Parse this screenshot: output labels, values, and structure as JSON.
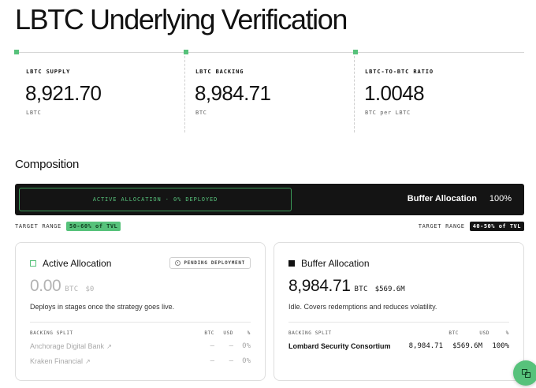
{
  "page": {
    "title": "LBTC Underlying Verification"
  },
  "stats": [
    {
      "label": "LBTC SUPPLY",
      "value": "8,921.70",
      "unit": "LBTC"
    },
    {
      "label": "LBTC BACKING",
      "value": "8,984.71",
      "unit": "BTC"
    },
    {
      "label": "LBTC-TO-BTC RATIO",
      "value": "1.0048",
      "unit": "BTC per LBTC"
    }
  ],
  "composition": {
    "title": "Composition",
    "bar": {
      "active_label": "ACTIVE ALLOCATION · 0% DEPLOYED",
      "buffer_label": "Buffer Allocation",
      "buffer_pct": "100%",
      "active_fraction": 0
    },
    "ranges": {
      "left_label": "TARGET RANGE",
      "left_badge": "50-60% of TVL",
      "right_label": "TARGET RANGE",
      "right_badge": "40-50% of TVL"
    }
  },
  "active_card": {
    "title": "Active Allocation",
    "badge": "PENDING DEPLOYMENT",
    "amount": "0.00",
    "unit": "BTC",
    "usd": "$0",
    "description": "Deploys in stages once the strategy goes live.",
    "split_header": {
      "name": "BACKING SPLIT",
      "btc": "BTC",
      "usd": "USD",
      "pct": "%"
    },
    "rows": [
      {
        "name": "Anchorage Digital Bank",
        "ext": "↗",
        "btc": "–",
        "usd": "–",
        "pct": "0%"
      },
      {
        "name": "Kraken Financial",
        "ext": "↗",
        "btc": "–",
        "usd": "–",
        "pct": "0%"
      }
    ]
  },
  "buffer_card": {
    "title": "Buffer Allocation",
    "amount": "8,984.71",
    "unit": "BTC",
    "usd": "$569.6M",
    "description": "Idle. Covers redemptions and reduces volatility.",
    "split_header": {
      "name": "BACKING SPLIT",
      "btc": "BTC",
      "usd": "USD",
      "pct": "%"
    },
    "rows": [
      {
        "name": "Lombard Security Consortium",
        "btc": "8,984.71",
        "usd": "$569.6M",
        "pct": "100%"
      }
    ]
  },
  "colors": {
    "accent": "#57c27b",
    "dark": "#141414"
  },
  "icons": {
    "fab": "copy-icon"
  }
}
